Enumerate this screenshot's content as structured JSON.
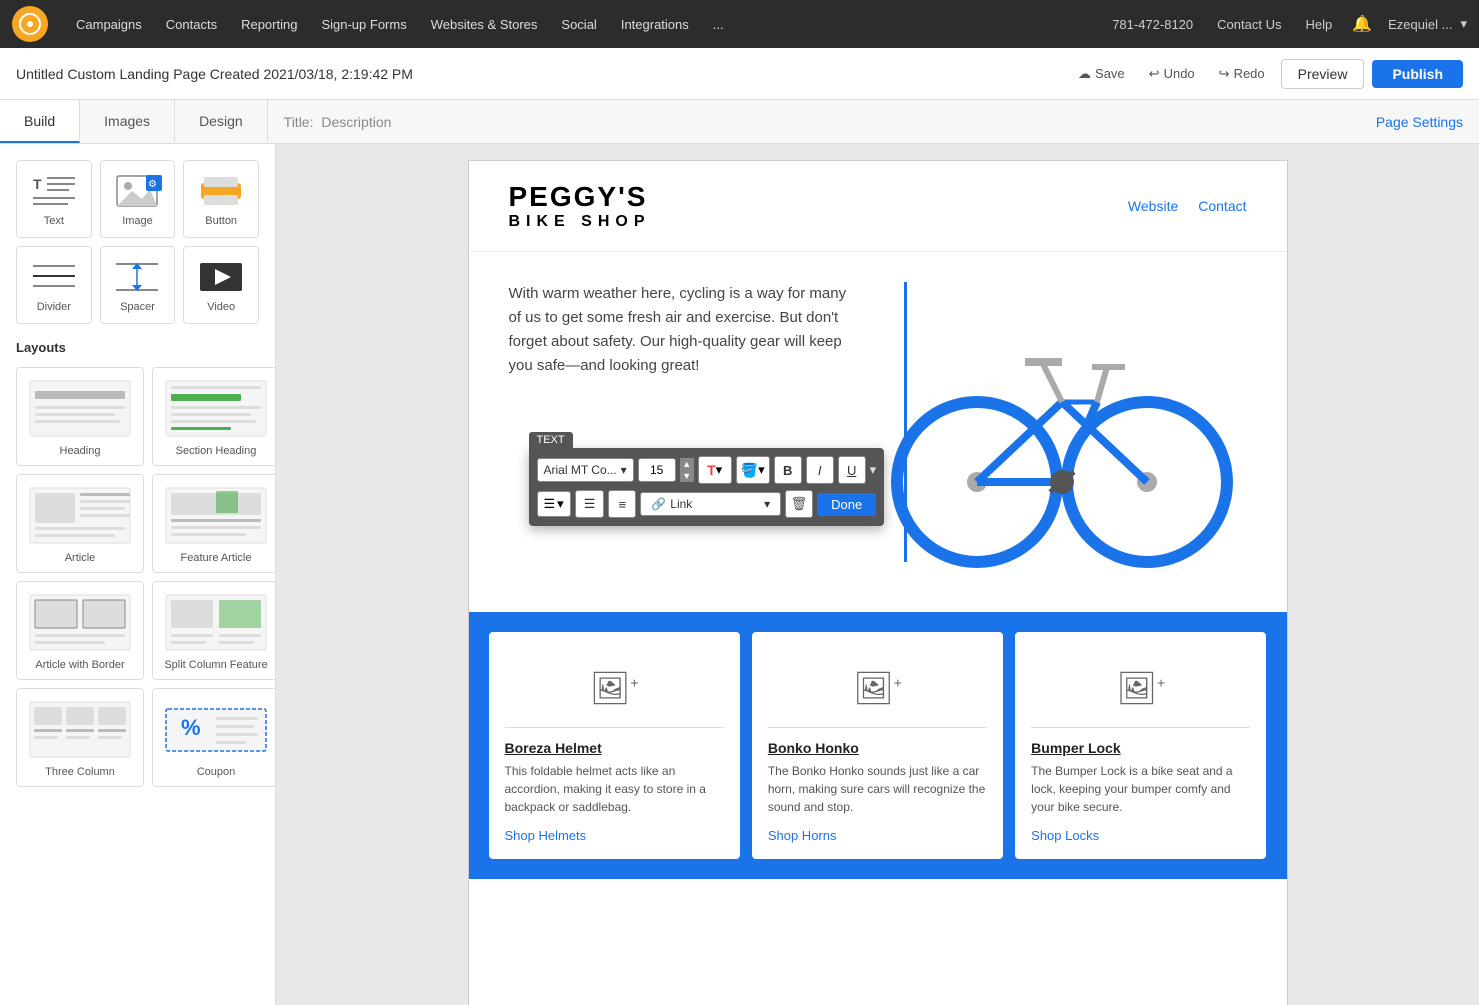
{
  "topNav": {
    "navItems": [
      "Campaigns",
      "Contacts",
      "Reporting",
      "Sign-up Forms",
      "Websites & Stores",
      "Social",
      "Integrations",
      "..."
    ],
    "phone": "781-472-8120",
    "contactUs": "Contact Us",
    "help": "Help",
    "user": "Ezequiel ..."
  },
  "secondBar": {
    "title": "Untitled Custom Landing Page Created 2021/03/18, 2:19:42 PM",
    "save": "Save",
    "undo": "Undo",
    "redo": "Redo",
    "preview": "Preview",
    "publish": "Publish"
  },
  "thirdBar": {
    "tabs": [
      "Build",
      "Images",
      "Design"
    ],
    "activeTab": "Build",
    "titleLabel": "Title:",
    "titleValue": "Description",
    "pageSettings": "Page Settings"
  },
  "sidebar": {
    "items": [
      {
        "label": "Text",
        "type": "text"
      },
      {
        "label": "Image",
        "type": "image"
      },
      {
        "label": "Button",
        "type": "button"
      },
      {
        "label": "Divider",
        "type": "divider"
      },
      {
        "label": "Spacer",
        "type": "spacer"
      },
      {
        "label": "Video",
        "type": "video"
      }
    ],
    "layoutsTitle": "Layouts",
    "layouts": [
      {
        "label": "Heading",
        "type": "heading"
      },
      {
        "label": "Section Heading",
        "type": "section-heading"
      },
      {
        "label": "Article",
        "type": "article"
      },
      {
        "label": "Feature Article",
        "type": "feature-article"
      },
      {
        "label": "Article with Border",
        "type": "article-border"
      },
      {
        "label": "Split Column Feature",
        "type": "split-column"
      },
      {
        "label": "Three Column",
        "type": "three-column"
      },
      {
        "label": "Coupon",
        "type": "coupon"
      }
    ]
  },
  "toolbar": {
    "label": "TEXT",
    "font": "Arial MT Co...",
    "fontSize": "15",
    "textColor": "T",
    "boldLabel": "B",
    "italicLabel": "I",
    "underlineLabel": "U",
    "linkLabel": "Link",
    "doneLabel": "Done"
  },
  "pageHeader": {
    "logoMain": "PEGGY'S",
    "logoSub": "BIKE SHOP",
    "links": [
      "Website",
      "Contact"
    ]
  },
  "heroText": "With warm weather here, cycling is a way for many of us to get some fresh air and exercise. But don't forget about safety. Our high-quality gear will keep you safe—and looking great!",
  "products": [
    {
      "title": "Boreza Helmet",
      "desc": "This foldable helmet acts like an accordion, making it easy to store in a backpack or saddlebag.",
      "link": "Shop Helmets"
    },
    {
      "title": "Bonko Honko",
      "desc": "The Bonko Honko sounds just like a car horn, making sure cars will recognize the sound and stop.",
      "link": "Shop Horns"
    },
    {
      "title": "Bumper Lock",
      "desc": "The Bumper Lock is a bike seat and a lock, keeping your bumper comfy and your bike secure.",
      "link": "Shop Locks"
    }
  ]
}
